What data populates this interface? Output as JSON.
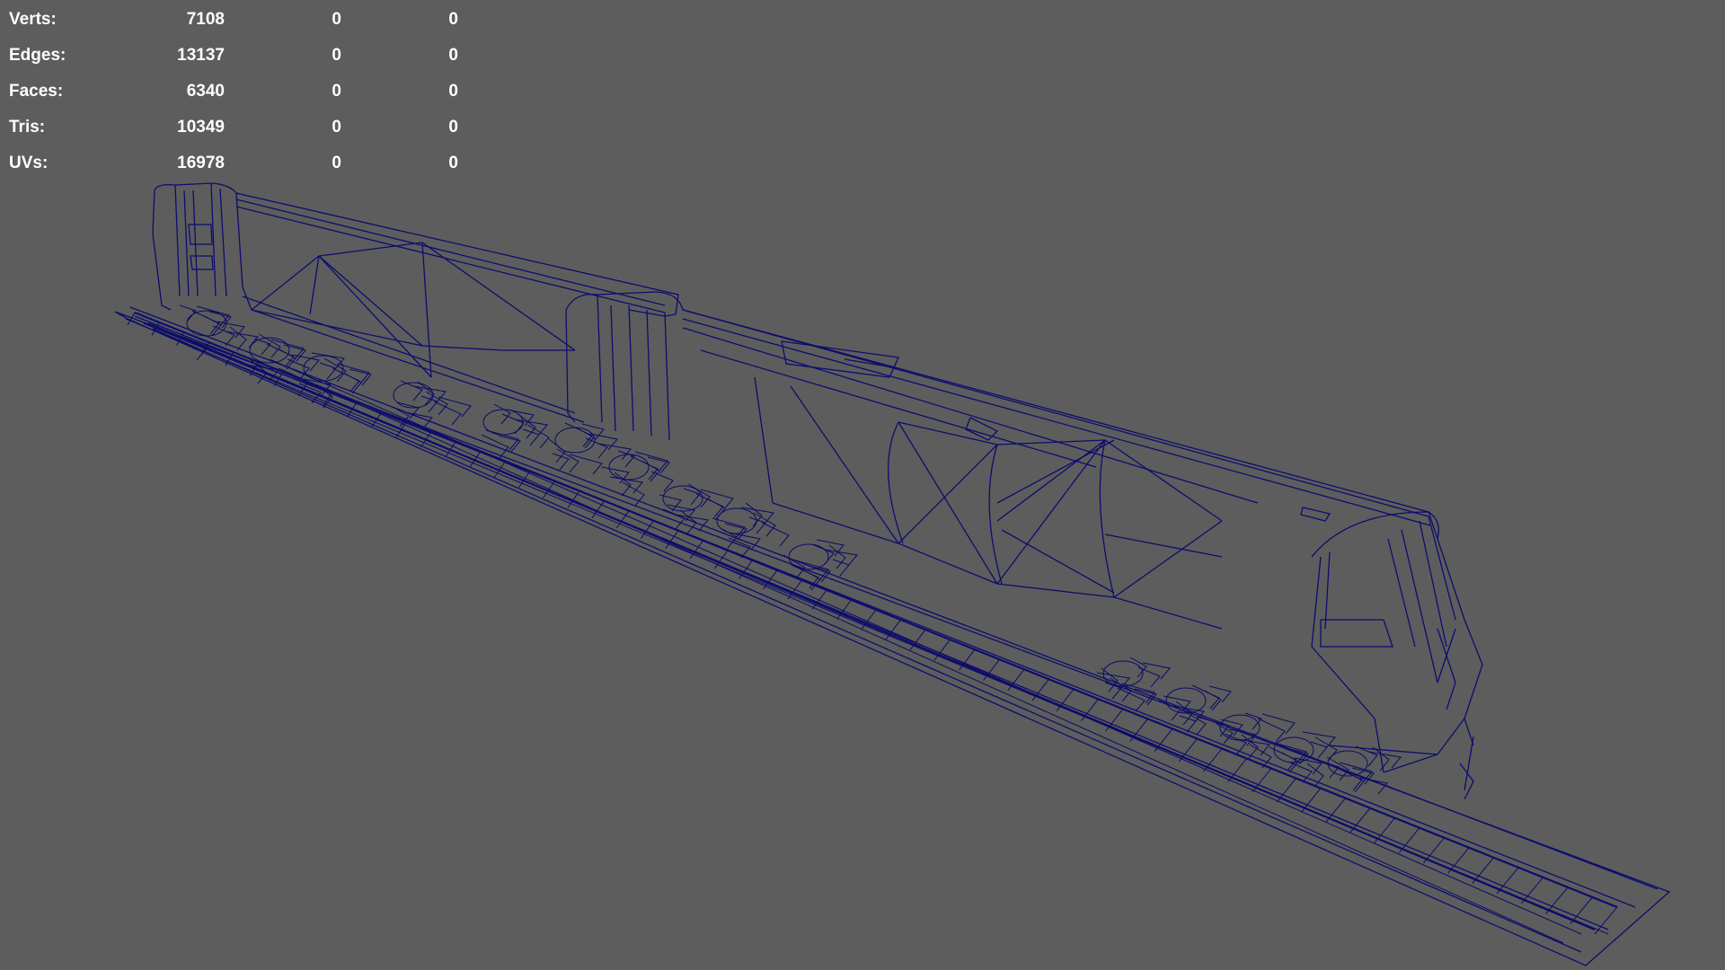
{
  "hud": {
    "rows": [
      {
        "label": "Verts:",
        "total": "7108",
        "selected": "0",
        "component": "0"
      },
      {
        "label": "Edges:",
        "total": "13137",
        "selected": "0",
        "component": "0"
      },
      {
        "label": "Faces:",
        "total": "6340",
        "selected": "0",
        "component": "0"
      },
      {
        "label": "Tris:",
        "total": "10349",
        "selected": "0",
        "component": "0"
      },
      {
        "label": "UVs:",
        "total": "16978",
        "selected": "0",
        "component": "0"
      }
    ]
  },
  "viewport": {
    "background_color": "#5d5d5d",
    "wireframe_color": "#0d0d6e",
    "display_mode": "wireframe"
  }
}
